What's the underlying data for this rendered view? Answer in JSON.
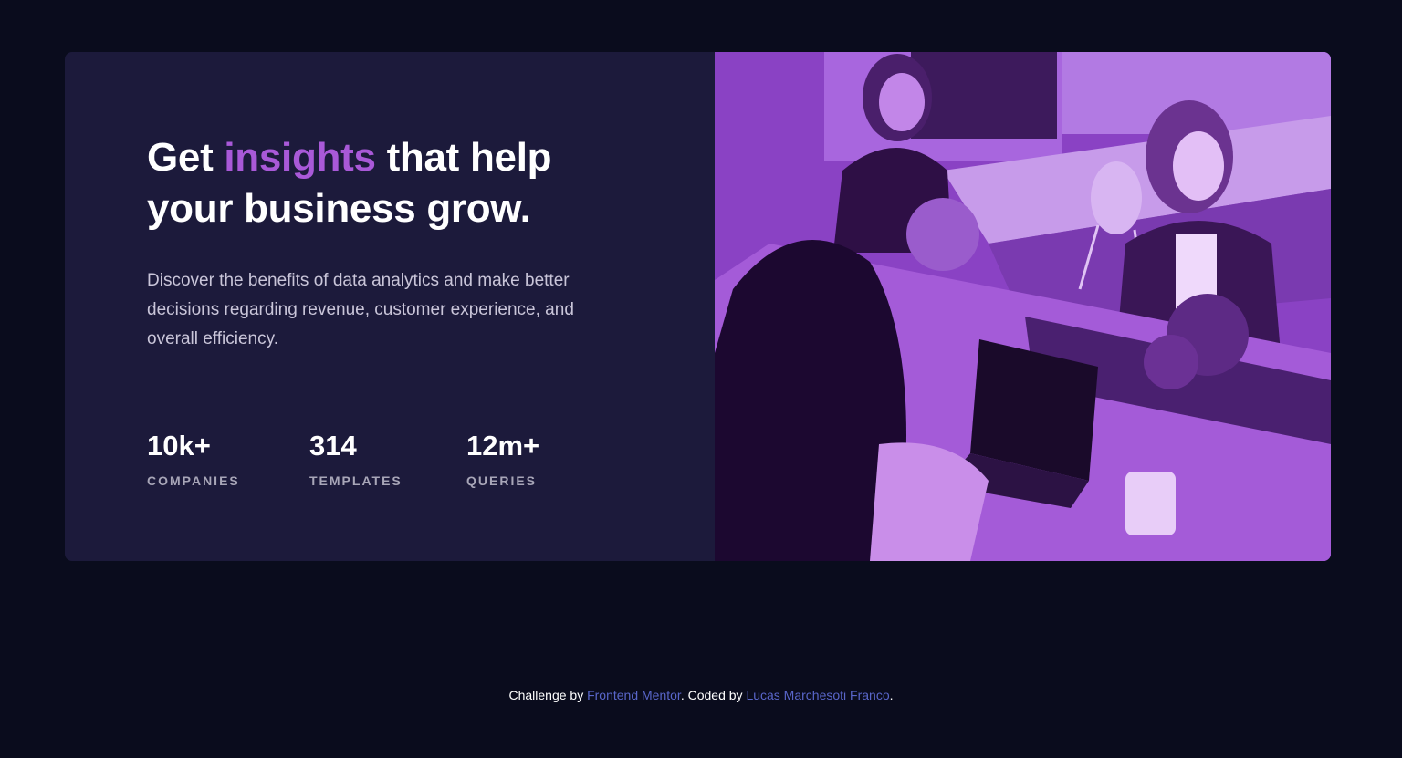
{
  "hero": {
    "headline_pre": "Get ",
    "headline_accent": "insights",
    "headline_post": " that help your business grow.",
    "description": "Discover the benefits of data analytics and make better decisions regarding revenue, customer experience, and overall efficiency.",
    "image_alt": "Three people working at a desk in an office",
    "accent_color": "#a959d8",
    "card_color": "#1c1a3b",
    "page_background": "#0a0c1d"
  },
  "stats": [
    {
      "value": "10k+",
      "label": "COMPANIES"
    },
    {
      "value": "314",
      "label": "TEMPLATES"
    },
    {
      "value": "12m+",
      "label": "QUERIES"
    }
  ],
  "footer": {
    "prefix": "Challenge by ",
    "link1": "Frontend Mentor",
    "middle": ". Coded by ",
    "link2": "Lucas Marchesoti Franco",
    "suffix": ".",
    "link_color": "#5966c9"
  }
}
